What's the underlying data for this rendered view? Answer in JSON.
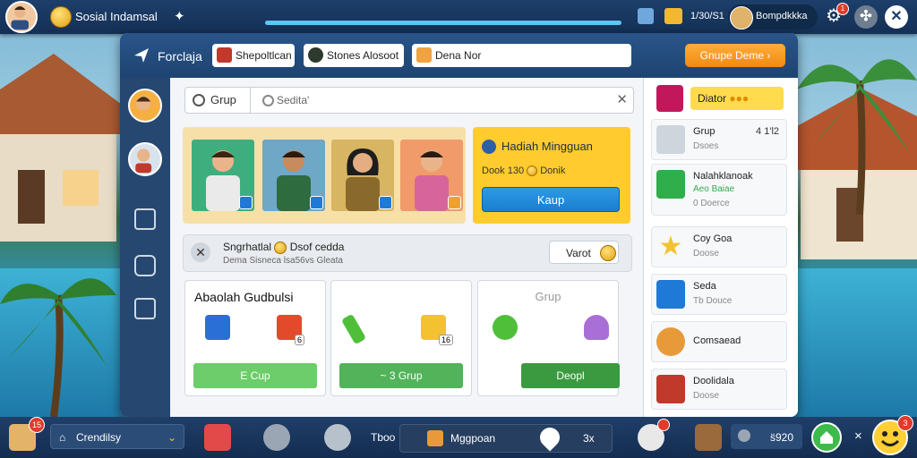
{
  "topbar": {
    "title": "Sosial Indamsal",
    "currency": "1/30/S1",
    "profile_name": "Bompdkkka",
    "notif_count": "1",
    "progress": 1.0
  },
  "panel": {
    "header_title": "Forclaja",
    "tabs": [
      {
        "label": "Shepoltlcan"
      },
      {
        "label": "Stones Alosoot"
      },
      {
        "label": "Dena Nor"
      }
    ],
    "action_button": "Gnupe Deme"
  },
  "search": {
    "group_label": "Grup",
    "placeholder": "Sedita'"
  },
  "gift": {
    "title": "Hadiah Mingguan",
    "subtitle": "Dook 130",
    "subtitle2": "Donik",
    "button": "Kaup"
  },
  "notice": {
    "title": "Sngrhatlal",
    "title2": "Dsof cedda",
    "subtitle": "Dema Sisneca lsa56vs Gleata",
    "vote_label": "Varot"
  },
  "cards": [
    {
      "title": "Abaolah Gudbulsi",
      "button": "E Cup",
      "badge": "6"
    },
    {
      "title": "",
      "button": "~ 3 Grup",
      "badge": "16"
    },
    {
      "title": "Grup",
      "button": "Deopl"
    }
  ],
  "rightcol": {
    "top_label": "Diator",
    "items": [
      {
        "line1": "Grup",
        "line2": "Dsoes",
        "value": "4 1'l2"
      },
      {
        "line1": "Nalahklanoak",
        "line2": "Aeo Baiae",
        "line3": "0 Doerce"
      },
      {
        "line1": "Coy Goa",
        "line2": "Doose"
      },
      {
        "line1": "Seda",
        "line2": "Tb Douce"
      },
      {
        "line1": "Comsaead",
        "line2": ""
      },
      {
        "line1": "Doolidala",
        "line2": "Doose"
      }
    ]
  },
  "bottombar": {
    "badge": "15",
    "community": "Crendilsy",
    "stat1": "Tboo",
    "marketplace": "Mggpoan",
    "stat2": "3x",
    "stat3": "s̈920",
    "close": "×",
    "emoji_badge": "3"
  },
  "colors": {
    "header": "#1e4371",
    "gift": "#ffcb2e",
    "accent_blue": "#1a7ed0",
    "green": "#63c063"
  }
}
